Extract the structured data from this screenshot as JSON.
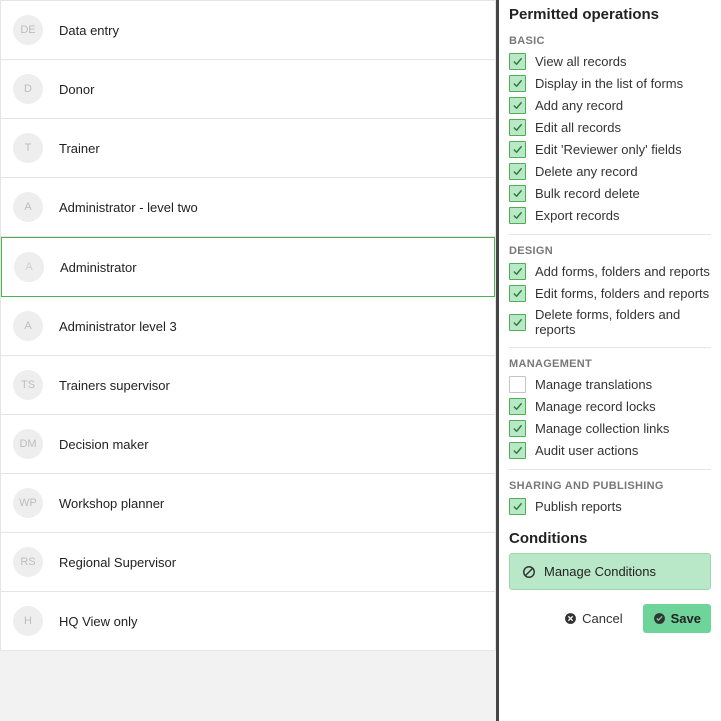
{
  "roles": [
    {
      "initials": "DE",
      "label": "Data entry",
      "selected": false
    },
    {
      "initials": "D",
      "label": "Donor",
      "selected": false
    },
    {
      "initials": "T",
      "label": "Trainer",
      "selected": false
    },
    {
      "initials": "A",
      "label": "Administrator - level two",
      "selected": false
    },
    {
      "initials": "A",
      "label": "Administrator",
      "selected": true
    },
    {
      "initials": "A",
      "label": "Administrator level 3",
      "selected": false
    },
    {
      "initials": "TS",
      "label": "Trainers supervisor",
      "selected": false
    },
    {
      "initials": "DM",
      "label": "Decision maker",
      "selected": false
    },
    {
      "initials": "WP",
      "label": "Workshop planner",
      "selected": false
    },
    {
      "initials": "RS",
      "label": "Regional Supervisor",
      "selected": false
    },
    {
      "initials": "H",
      "label": "HQ View only",
      "selected": false
    }
  ],
  "permissions": {
    "title": "Permitted operations",
    "groups": [
      {
        "label": "BASIC",
        "items": [
          {
            "label": "View all records",
            "checked": true
          },
          {
            "label": "Display in the list of forms",
            "checked": true
          },
          {
            "label": "Add any record",
            "checked": true
          },
          {
            "label": "Edit all records",
            "checked": true
          },
          {
            "label": "Edit 'Reviewer only' fields",
            "checked": true
          },
          {
            "label": "Delete any record",
            "checked": true
          },
          {
            "label": "Bulk record delete",
            "checked": true
          },
          {
            "label": "Export records",
            "checked": true
          }
        ]
      },
      {
        "label": "DESIGN",
        "items": [
          {
            "label": "Add forms, folders and reports",
            "checked": true
          },
          {
            "label": "Edit forms, folders and reports",
            "checked": true
          },
          {
            "label": "Delete forms, folders and reports",
            "checked": true
          }
        ]
      },
      {
        "label": "MANAGEMENT",
        "items": [
          {
            "label": "Manage translations",
            "checked": false
          },
          {
            "label": "Manage record locks",
            "checked": true
          },
          {
            "label": "Manage collection links",
            "checked": true
          },
          {
            "label": "Audit user actions",
            "checked": true
          }
        ]
      },
      {
        "label": "SHARING AND PUBLISHING",
        "items": [
          {
            "label": "Publish reports",
            "checked": true
          }
        ]
      }
    ]
  },
  "conditions": {
    "title": "Conditions",
    "manage_label": "Manage Conditions"
  },
  "footer": {
    "cancel": "Cancel",
    "save": "Save"
  }
}
